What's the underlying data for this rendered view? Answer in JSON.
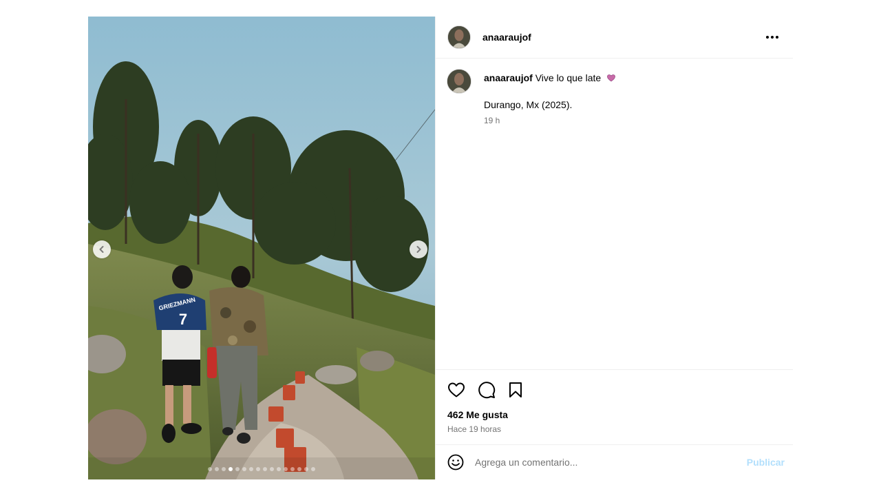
{
  "post": {
    "username": "anaaraujof",
    "caption": {
      "username": "anaaraujof",
      "text": "Vive lo que late",
      "emoji": "heart-emoji",
      "location_line": "Durango, Mx (2025).",
      "time": "19 h"
    },
    "carousel": {
      "total_slides": 16,
      "current_slide": 4,
      "icons": {
        "prev": "chevron-left-icon",
        "next": "chevron-right-icon"
      }
    },
    "photo": {
      "jersey_text": "GRIEZMANN",
      "jersey_number": "7"
    },
    "actions": {
      "icons": [
        "heart-icon",
        "comment-icon",
        "bookmark-icon"
      ]
    },
    "likes_text": "462 Me gusta",
    "posted_time": "Hace 19 horas",
    "comment": {
      "placeholder": "Agrega un comentario...",
      "value": "",
      "publish_label": "Publicar",
      "emoji_icon": "smiley-icon"
    },
    "colors": {
      "publish_disabled": "#b2dffc",
      "secondary_text": "#737373",
      "divider": "#efefef"
    }
  }
}
